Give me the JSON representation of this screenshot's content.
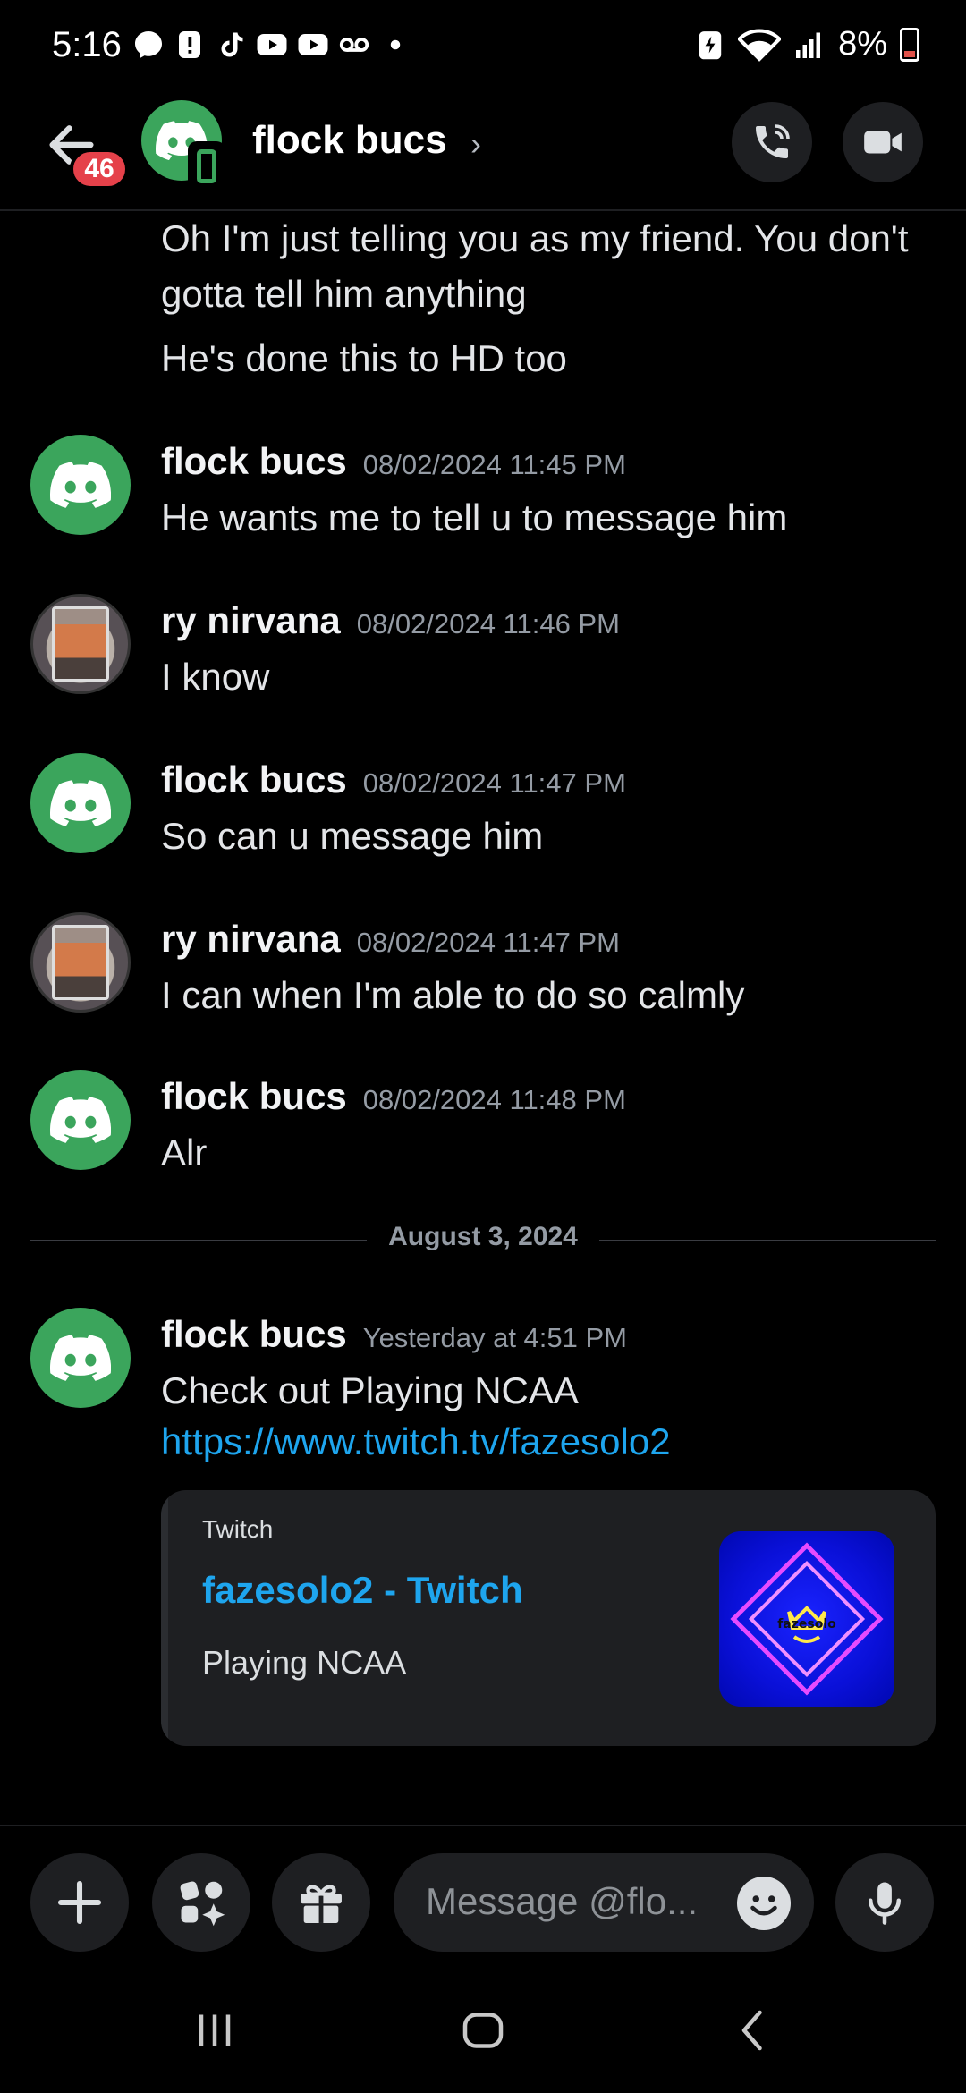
{
  "status_bar": {
    "time": "5:16",
    "battery_text": "8%",
    "icons_left": [
      "messenger-icon",
      "alert-icon",
      "tiktok-icon",
      "youtube-icon",
      "youtube-icon",
      "voicemail-icon",
      "dot-icon"
    ],
    "icons_right": [
      "battery-saver-icon",
      "wifi-icon",
      "signal-icon",
      "battery-icon"
    ]
  },
  "header": {
    "name": "flock bucs",
    "unread_badge": "46"
  },
  "messages": [
    {
      "continuation": [
        "Oh I'm just telling you as my friend. You don't",
        "gotta tell him anything",
        "He's done this to HD too"
      ]
    },
    {
      "author": "flock bucs",
      "timestamp": "08/02/2024 11:45 PM",
      "text": "He wants me to tell u to message him"
    },
    {
      "author": "ry nirvana",
      "timestamp": "08/02/2024 11:46 PM",
      "text": "I know"
    },
    {
      "author": "flock bucs",
      "timestamp": "08/02/2024 11:47 PM",
      "text": "So can u message him"
    },
    {
      "author": "ry nirvana",
      "timestamp": "08/02/2024 11:47 PM",
      "text": "I can when I'm able to do so calmly"
    },
    {
      "author": "flock bucs",
      "timestamp": "08/02/2024 11:48 PM",
      "text": "Alr"
    },
    {
      "author": "flock bucs",
      "timestamp": "Yesterday at 4:51 PM",
      "text": "Check out Playing NCAA",
      "link": "https://www.twitch.tv/fazesolo2"
    }
  ],
  "date_divider": "August 3, 2024",
  "embed": {
    "provider": "Twitch",
    "title": "fazesolo2 - Twitch",
    "description": "Playing NCAA",
    "thumb_text": "fazesolo"
  },
  "composer": {
    "placeholder": "Message @flo..."
  },
  "colors": {
    "background": "#000000",
    "discord_green": "#3ba55c",
    "link_blue": "#1ea5ee",
    "badge_red": "#e5414a"
  }
}
